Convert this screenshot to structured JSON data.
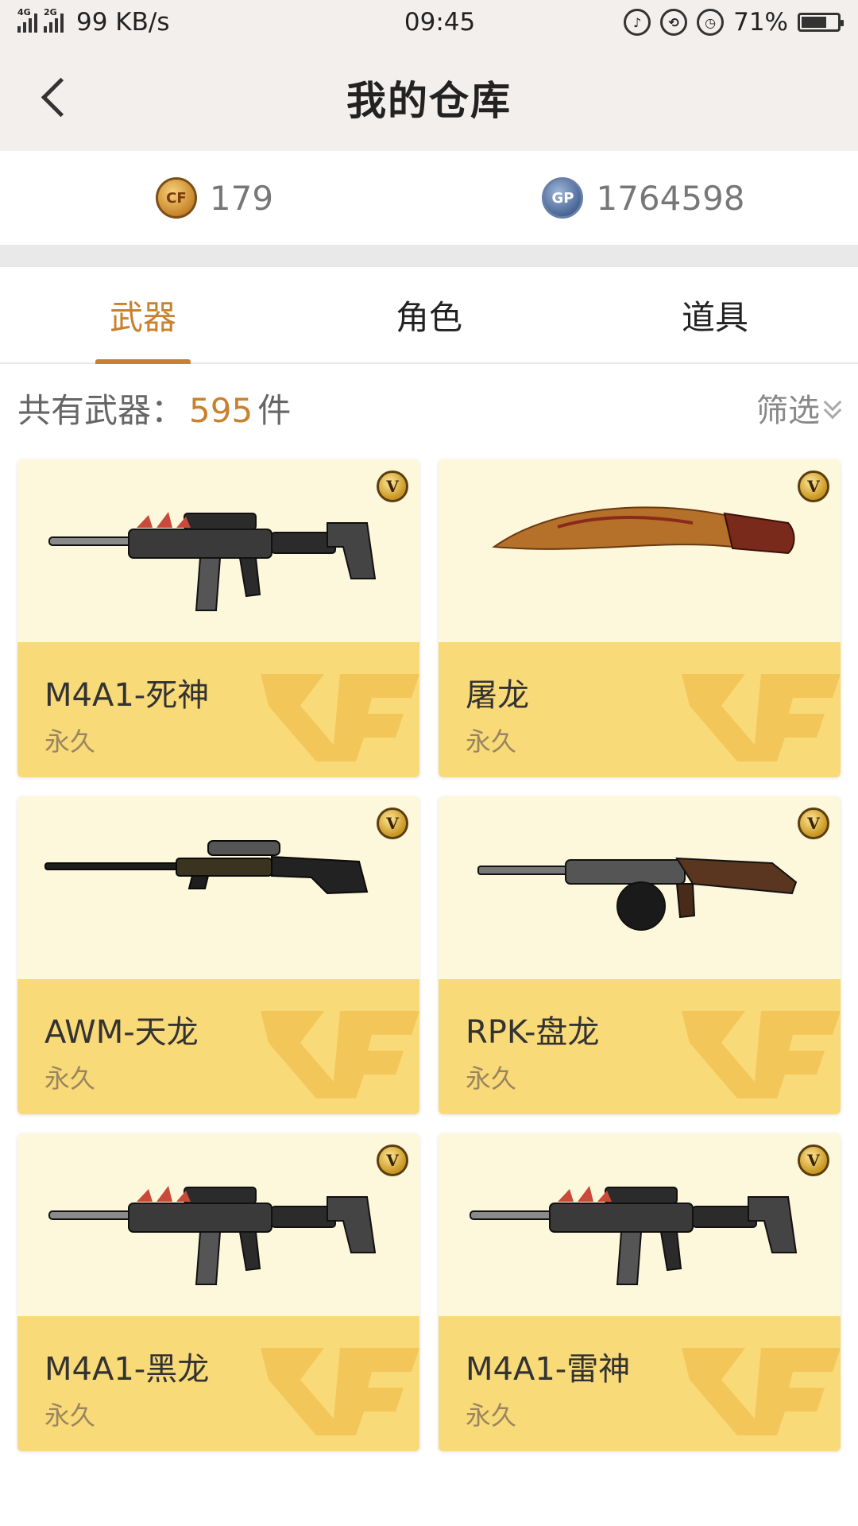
{
  "status_bar": {
    "network_left": "4G",
    "network_right": "2G",
    "speed": "99 KB/s",
    "time": "09:45",
    "battery_percent": "71%",
    "battery_level": 0.71,
    "icons": [
      "vibrate-icon",
      "rotation-lock-icon",
      "alarm-icon",
      "battery-icon"
    ]
  },
  "header": {
    "title": "我的仓库",
    "back_icon": "back-arrow-icon"
  },
  "currency": {
    "cf_points": "179",
    "gp_points": "1764598",
    "cf_icon_label": "CF",
    "gp_icon_label": "GP"
  },
  "tabs": [
    {
      "label": "武器",
      "active": true
    },
    {
      "label": "角色",
      "active": false
    },
    {
      "label": "道具",
      "active": false
    }
  ],
  "summary": {
    "prefix": "共有武器：",
    "count": "595",
    "suffix": "件",
    "filter_label": "筛选"
  },
  "items": [
    {
      "name": "M4A1-死神",
      "duration": "永久",
      "weapon": "rifle",
      "badge": "V"
    },
    {
      "name": "屠龙",
      "duration": "永久",
      "weapon": "knife",
      "badge": "V"
    },
    {
      "name": "AWM-天龙",
      "duration": "永久",
      "weapon": "sniper",
      "badge": "V"
    },
    {
      "name": "RPK-盘龙",
      "duration": "永久",
      "weapon": "lmg",
      "badge": "V"
    },
    {
      "name": "M4A1-黑龙",
      "duration": "永久",
      "weapon": "rifle",
      "badge": "V"
    },
    {
      "name": "M4A1-雷神",
      "duration": "永久",
      "weapon": "rifle",
      "badge": "V"
    }
  ],
  "colors": {
    "accent": "#c8812e",
    "card_top": "#fdf8dc",
    "card_bottom": "#f9da78"
  }
}
